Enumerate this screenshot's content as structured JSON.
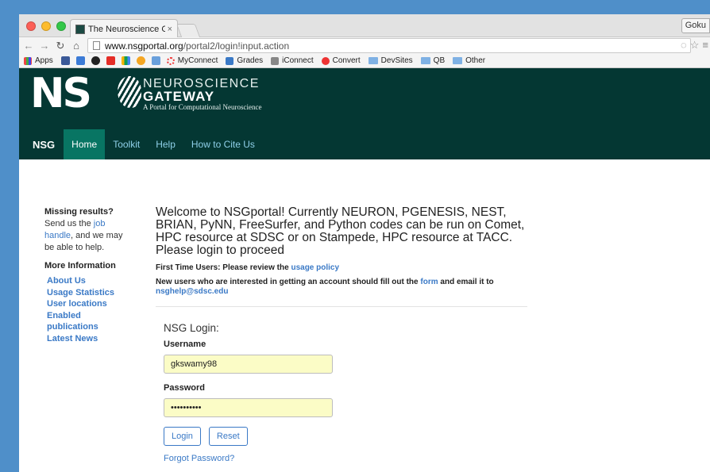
{
  "browser": {
    "tab_title": "The Neuroscience Gateway",
    "tab_close": "×",
    "profile": "Goku",
    "url_domain": "www.nsgportal.org",
    "url_path": "/portal2/login!input.action",
    "bookmarks": [
      "Apps",
      "MyConnect",
      "Grades",
      "iConnect",
      "Convert",
      "DevSites",
      "QB",
      "Other"
    ]
  },
  "site": {
    "logo_letters": "NS",
    "logo_line1": "NEUROSCIENCE",
    "logo_line2": "GATEWAY",
    "logo_line3": "A Portal for Computational Neuroscience",
    "nav": {
      "brand": "NSG",
      "items": [
        "Home",
        "Toolkit",
        "Help",
        "How to Cite Us"
      ]
    }
  },
  "sidebar": {
    "missing_title": "Missing results?",
    "missing_pre": "Send us the",
    "missing_link": "job handle",
    "missing_post": ", and we may be able to help.",
    "more_title": "More Information",
    "links": [
      "About Us",
      "Usage Statistics",
      "User locations",
      "Enabled publications",
      "Latest News"
    ]
  },
  "main": {
    "welcome": "Welcome to NSGportal! Currently NEURON, PGENESIS, NEST, BRIAN, PyNN, FreeSurfer, and Python codes can be run on Comet, HPC resource at SDSC or on Stampede, HPC resource at TACC. Please login to proceed",
    "first_time_pre": "First Time Users: Please review the",
    "first_time_link": "usage policy",
    "new_users_pre": "New users who are interested in getting an account should fill out the",
    "new_users_link": "form",
    "new_users_mid": "and email it to",
    "new_users_email": "nsghelp@sdsc.edu"
  },
  "login": {
    "title": "NSG Login:",
    "username_label": "Username",
    "username_value": "gkswamy98",
    "password_label": "Password",
    "password_value": "••••••••••",
    "login_button": "Login",
    "reset_button": "Reset",
    "forgot": "Forgot Password?"
  }
}
